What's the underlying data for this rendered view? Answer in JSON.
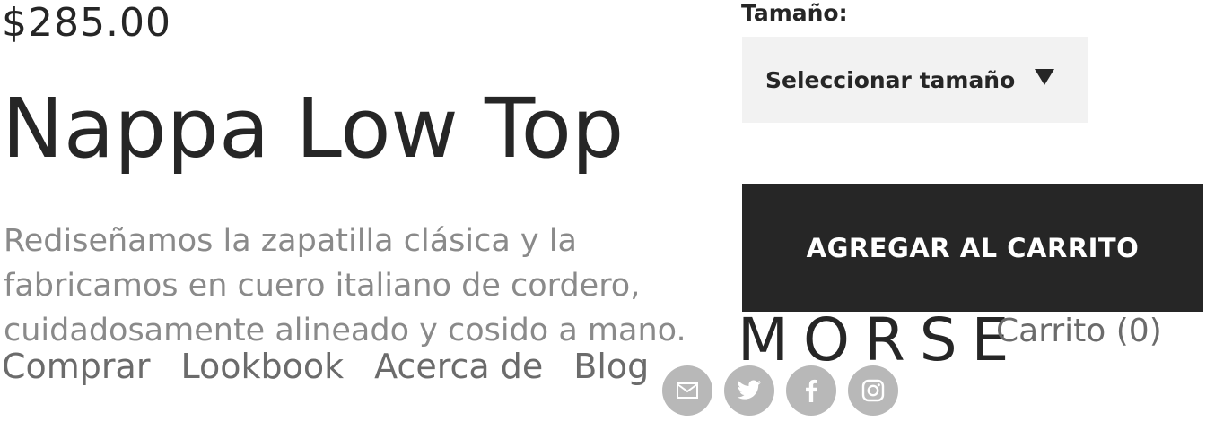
{
  "product": {
    "price": "$285.00",
    "title": "Nappa Low Top",
    "description": "Rediseñamos la zapatilla clásica y la fabricamos en cuero italiano de cordero, cuidadosamente alineado y cosido a mano."
  },
  "nav": {
    "items": [
      {
        "label": "Comprar"
      },
      {
        "label": "Lookbook"
      },
      {
        "label": "Acerca de"
      },
      {
        "label": "Blog"
      }
    ]
  },
  "size": {
    "label": "Tamaño:",
    "selected": "Seleccionar tamaño"
  },
  "cart": {
    "add_label": "AGREGAR AL CARRITO",
    "link_label": "Carrito (0)"
  },
  "brand": {
    "logo": "MORSE"
  },
  "social": {
    "icons": [
      "email-icon",
      "twitter-icon",
      "facebook-icon",
      "instagram-icon"
    ]
  },
  "colors": {
    "text": "#262626",
    "muted": "#8a8a8a",
    "button_bg": "#262626",
    "select_bg": "#f2f2f2",
    "social_bg": "#b8b8b8"
  }
}
